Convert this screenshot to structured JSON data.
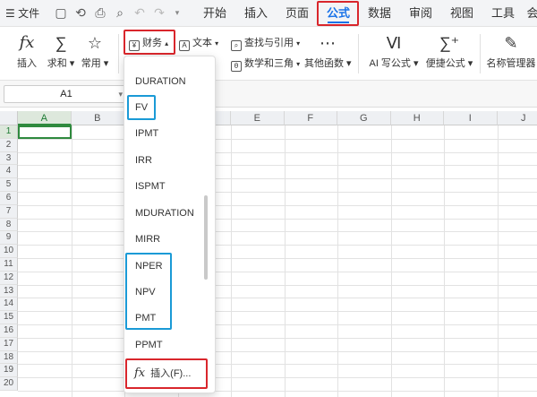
{
  "menubar": {
    "menu_icon": "hamburger-icon",
    "file_label": "文件",
    "tabs": [
      "开始",
      "插入",
      "页面",
      "公式",
      "数据",
      "审阅",
      "视图",
      "工具",
      "会"
    ],
    "active_tab": "公式"
  },
  "ribbon": {
    "insert_fn": "插入",
    "autosum": "求和",
    "common": "常用",
    "finance": "财务",
    "text": "文本",
    "lookup": "查找与引用",
    "math": "数学和三角",
    "other": "其他函数",
    "ai_formula": "AI 写公式",
    "quick_formula": "便捷公式",
    "name_manager": "名称管理器"
  },
  "formula_bar": {
    "cell_ref": "A1"
  },
  "grid": {
    "columns": [
      "A",
      "B",
      "C",
      "D",
      "E",
      "F",
      "G",
      "H",
      "I",
      "J"
    ],
    "rows": [
      "1",
      "2",
      "3",
      "4",
      "5",
      "6",
      "7",
      "8",
      "9",
      "10",
      "11",
      "12",
      "13",
      "14",
      "15",
      "16",
      "17",
      "18",
      "19",
      "20"
    ]
  },
  "dropdown": {
    "items": [
      "DURATION",
      "FV",
      "IPMT",
      "IRR",
      "ISPMT",
      "MDURATION",
      "MIRR",
      "NPER",
      "NPV",
      "PMT",
      "PPMT"
    ],
    "insert_label": "插入(F)..."
  },
  "colors": {
    "accent": "#1a73e8",
    "highlight_red": "#d9262c",
    "highlight_blue": "#1a9ad6",
    "cell_green": "#2f8a3e"
  }
}
